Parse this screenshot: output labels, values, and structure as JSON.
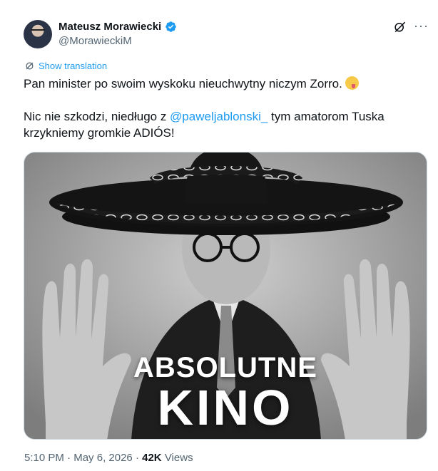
{
  "author": {
    "name": "Mateusz Morawiecki",
    "handle": "@MorawieckiM"
  },
  "translate": {
    "label": "Show translation"
  },
  "tweet": {
    "line1": "Pan minister po swoim wyskoku nieuchwytny niczym Zorro.",
    "line2_before": "Nic nie szkodzi, niedługo z ",
    "mention": "@paweljablonski_",
    "line2_after": " tym amatorom Tuska",
    "line3": "krzykniemy gromkie ADIÓS!"
  },
  "media": {
    "overlay_line1": "ABSOLUTNE",
    "overlay_line2": "KINO"
  },
  "meta": {
    "time": "5:10 PM",
    "sep1": " · ",
    "date": "May 6, 2026",
    "sep2": " · ",
    "views_count": "42K",
    "views_label": " Views"
  },
  "colors": {
    "accent": "#1d9bf0",
    "text": "#0f1419",
    "secondary": "#536471"
  },
  "icons": [
    "verified-badge-icon",
    "grok-icon",
    "more-icon",
    "translate-icon",
    "emoji-icon"
  ]
}
